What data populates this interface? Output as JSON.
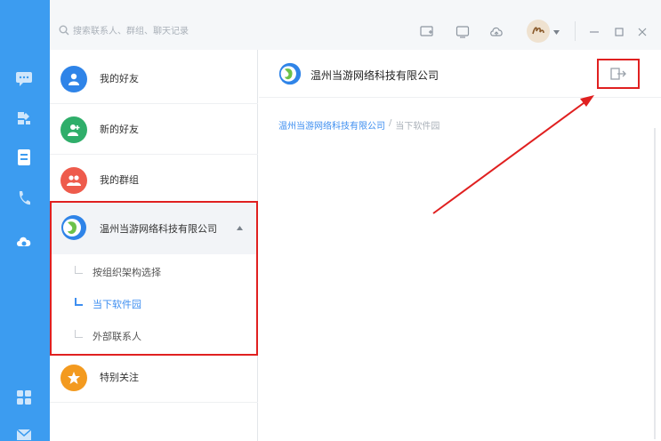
{
  "search": {
    "placeholder": "搜索联系人、群组、聊天记录"
  },
  "window_controls": [
    "minimize",
    "maximize",
    "close"
  ],
  "contacts": {
    "my_friends": "我的好友",
    "new_friends": "新的好友",
    "my_groups": "我的群组",
    "company": {
      "name": "温州当游网络科技有限公司",
      "expanded": true,
      "children": [
        {
          "label": "按组织架构选择",
          "active": false
        },
        {
          "label": "当下软件园",
          "active": true
        },
        {
          "label": "外部联系人",
          "active": false
        }
      ]
    },
    "special_follow": "特别关注"
  },
  "main": {
    "title": "温州当游网络科技有限公司",
    "breadcrumb": {
      "root": "温州当游网络科技有限公司",
      "separator": "/",
      "current": "当下软件园"
    }
  },
  "colors": {
    "rail": "#3c9cf0",
    "accent": "#3d8ef0",
    "highlight": "#e02020",
    "friends_avatar": "#2f84e8",
    "new_friends_avatar": "#2fae6a",
    "groups_avatar": "#ee5b4c",
    "special_avatar": "#f39a1f"
  }
}
